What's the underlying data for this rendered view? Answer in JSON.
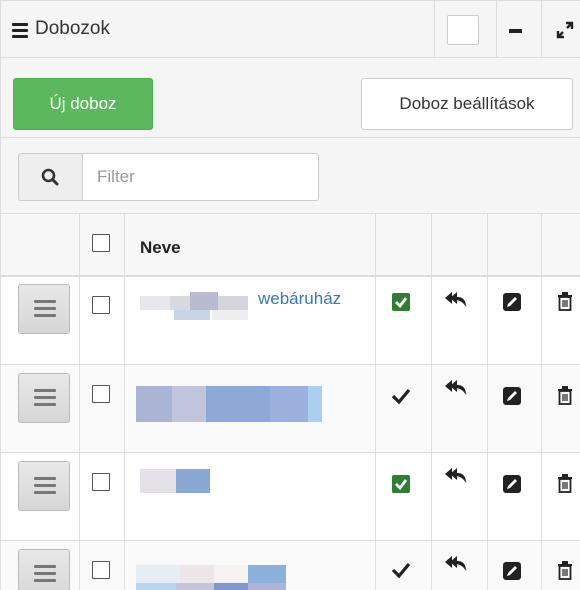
{
  "header": {
    "title": "Dobozok"
  },
  "toolbar": {
    "new_label": "Új doboz",
    "settings_label": "Doboz beállítások"
  },
  "filter": {
    "placeholder": "Filter",
    "value": ""
  },
  "table": {
    "columns": {
      "name": "Neve"
    },
    "rows": [
      {
        "name_visible": "webáruház",
        "active": "checked-box"
      },
      {
        "name_visible": "",
        "active": "checkmark"
      },
      {
        "name_visible": "",
        "active": "checked-box"
      },
      {
        "name_visible": "",
        "active": "checkmark"
      }
    ]
  },
  "colors": {
    "green": "#5cb85c",
    "link": "#337ab7",
    "check_green": "#2e7d32"
  }
}
